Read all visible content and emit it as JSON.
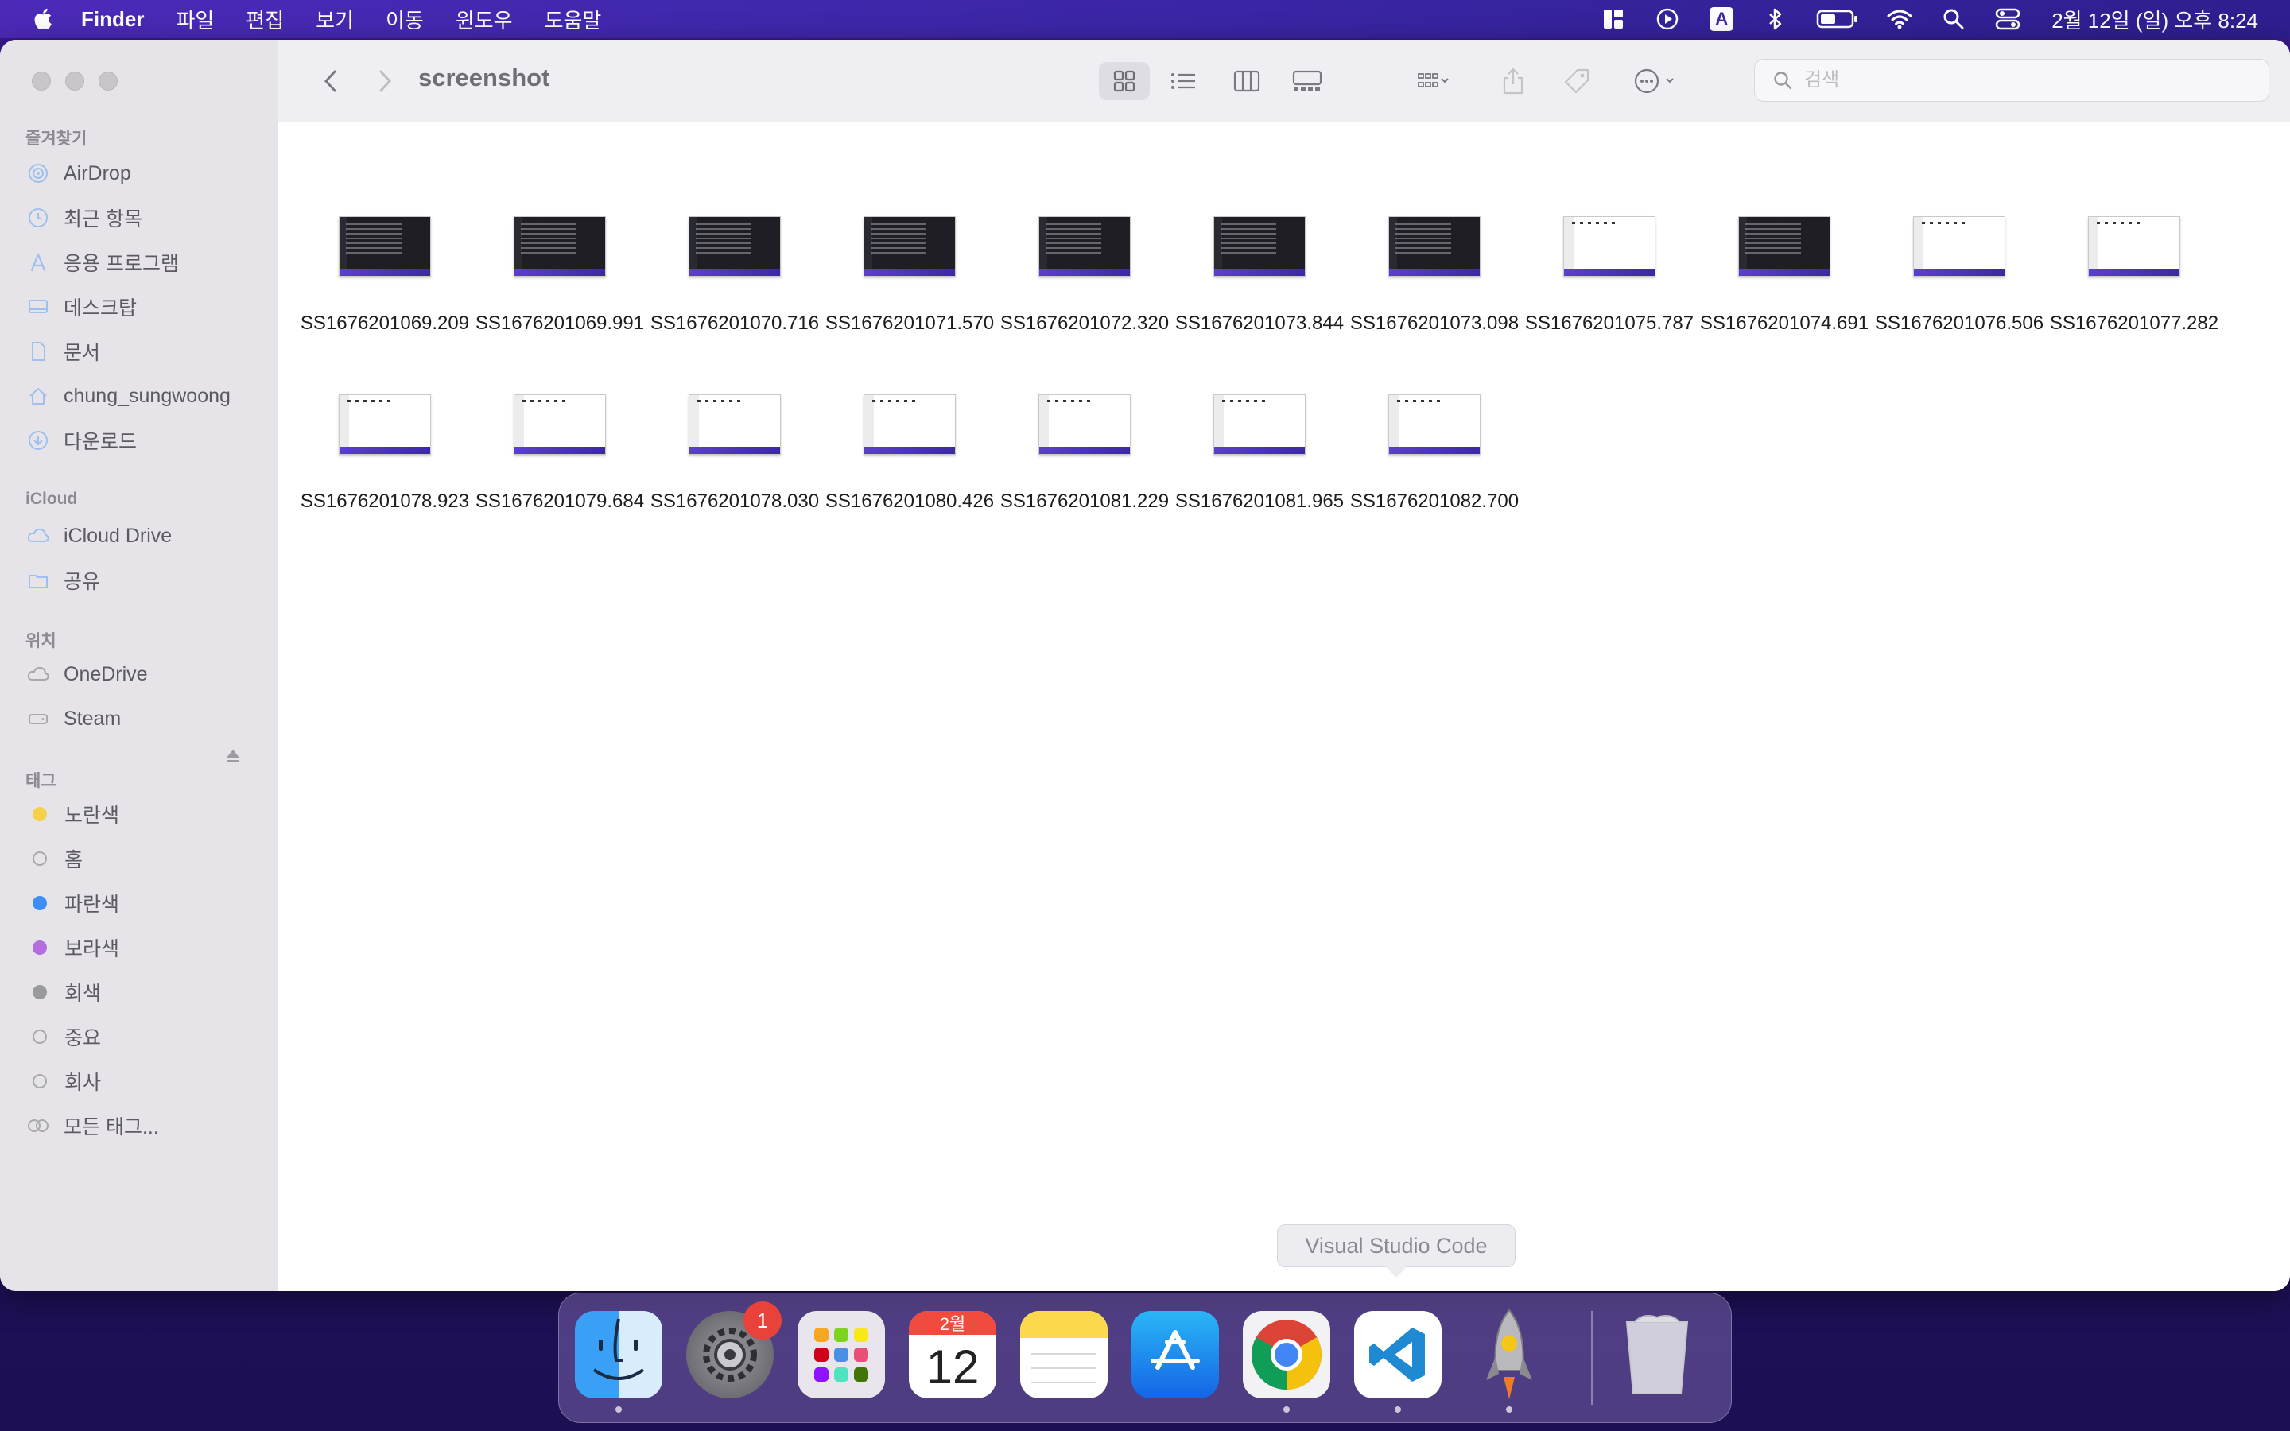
{
  "menubar": {
    "app_name": "Finder",
    "menus": [
      "파일",
      "편집",
      "보기",
      "이동",
      "윈도우",
      "도움말"
    ],
    "input_method": "A",
    "clock": "2월 12일 (일) 오후 8:24"
  },
  "window": {
    "title": "screenshot",
    "search_placeholder": "검색"
  },
  "sidebar": {
    "favorites_header": "즐겨찾기",
    "favorites": [
      {
        "label": "AirDrop",
        "icon": "airdrop-icon"
      },
      {
        "label": "최근 항목",
        "icon": "clock-icon"
      },
      {
        "label": "응용 프로그램",
        "icon": "applications-icon"
      },
      {
        "label": "데스크탑",
        "icon": "desktop-icon"
      },
      {
        "label": "문서",
        "icon": "document-icon"
      },
      {
        "label": "chung_sungwoong",
        "icon": "home-icon"
      },
      {
        "label": "다운로드",
        "icon": "download-icon"
      }
    ],
    "icloud_header": "iCloud",
    "icloud": [
      {
        "label": "iCloud Drive",
        "icon": "cloud-icon"
      },
      {
        "label": "공유",
        "icon": "shared-folder-icon"
      }
    ],
    "locations_header": "위치",
    "locations": [
      {
        "label": "OneDrive",
        "icon": "cloud-icon"
      },
      {
        "label": "Steam",
        "icon": "drive-icon"
      }
    ],
    "tags_header": "태그",
    "tags": [
      {
        "label": "노란색",
        "color": "#f5d14a"
      },
      {
        "label": "홈",
        "color": ""
      },
      {
        "label": "파란색",
        "color": "#3f8ef5"
      },
      {
        "label": "보라색",
        "color": "#b36ddd"
      },
      {
        "label": "회색",
        "color": "#9a999e"
      },
      {
        "label": "중요",
        "color": ""
      },
      {
        "label": "회사",
        "color": ""
      },
      {
        "label": "모든 태그...",
        "color": "all"
      }
    ]
  },
  "files": [
    {
      "name": "SS1676201069.209",
      "theme": "dark"
    },
    {
      "name": "SS1676201069.991",
      "theme": "dark"
    },
    {
      "name": "SS1676201070.716",
      "theme": "dark"
    },
    {
      "name": "SS1676201071.570",
      "theme": "dark"
    },
    {
      "name": "SS1676201072.320",
      "theme": "dark"
    },
    {
      "name": "SS1676201073.844",
      "theme": "dark"
    },
    {
      "name": "SS1676201073.098",
      "theme": "dark"
    },
    {
      "name": "SS1676201075.787",
      "theme": "light"
    },
    {
      "name": "SS1676201074.691",
      "theme": "dark"
    },
    {
      "name": "SS1676201076.506",
      "theme": "light"
    },
    {
      "name": "SS1676201077.282",
      "theme": "light"
    },
    {
      "name": "SS1676201078.923",
      "theme": "light"
    },
    {
      "name": "SS1676201079.684",
      "theme": "light"
    },
    {
      "name": "SS1676201078.030",
      "theme": "light"
    },
    {
      "name": "SS1676201080.426",
      "theme": "light"
    },
    {
      "name": "SS1676201081.229",
      "theme": "light"
    },
    {
      "name": "SS1676201081.965",
      "theme": "light"
    },
    {
      "name": "SS1676201082.700",
      "theme": "light"
    }
  ],
  "tooltip": "Visual Studio Code",
  "dock": {
    "settings_badge": "1",
    "calendar_month": "2월",
    "calendar_day": "12"
  }
}
